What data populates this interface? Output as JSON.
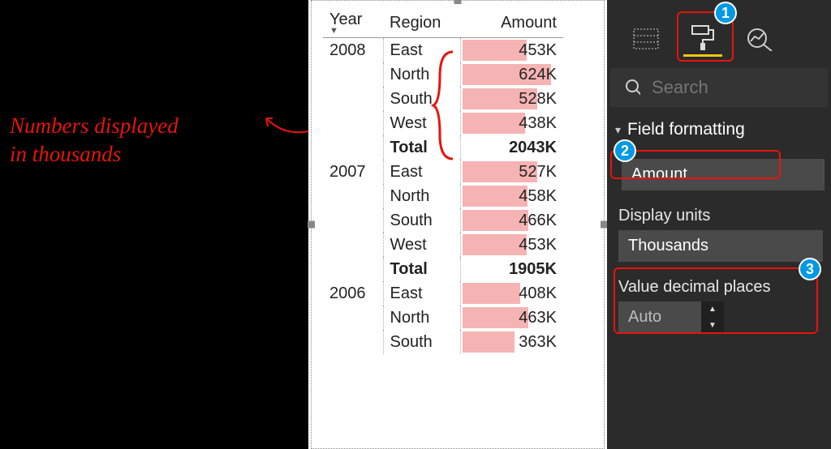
{
  "annotation": {
    "line1": "Numbers displayed",
    "line2": "in thousands"
  },
  "table": {
    "headers": {
      "year": "Year",
      "region": "Region",
      "amount": "Amount"
    },
    "groups": [
      {
        "year": "2008",
        "rows": [
          {
            "region": "East",
            "value": "453K",
            "bar_pct": 67
          },
          {
            "region": "North",
            "value": "624K",
            "bar_pct": 92
          },
          {
            "region": "South",
            "value": "528K",
            "bar_pct": 78
          },
          {
            "region": "West",
            "value": "438K",
            "bar_pct": 65
          }
        ],
        "total_label": "Total",
        "total_value": "2043K"
      },
      {
        "year": "2007",
        "rows": [
          {
            "region": "East",
            "value": "527K",
            "bar_pct": 78
          },
          {
            "region": "North",
            "value": "458K",
            "bar_pct": 68
          },
          {
            "region": "South",
            "value": "466K",
            "bar_pct": 69
          },
          {
            "region": "West",
            "value": "453K",
            "bar_pct": 67
          }
        ],
        "total_label": "Total",
        "total_value": "1905K"
      },
      {
        "year": "2006",
        "rows": [
          {
            "region": "East",
            "value": "408K",
            "bar_pct": 60
          },
          {
            "region": "North",
            "value": "463K",
            "bar_pct": 69
          },
          {
            "region": "South",
            "value": "363K",
            "bar_pct": 54
          }
        ]
      }
    ]
  },
  "pane": {
    "search_placeholder": "Search",
    "section": "Field formatting",
    "field": "Amount",
    "display_units_label": "Display units",
    "display_units_value": "Thousands",
    "decimal_label": "Value decimal places",
    "decimal_value": "Auto"
  },
  "callouts": {
    "c1": "1",
    "c2": "2",
    "c3": "3"
  }
}
